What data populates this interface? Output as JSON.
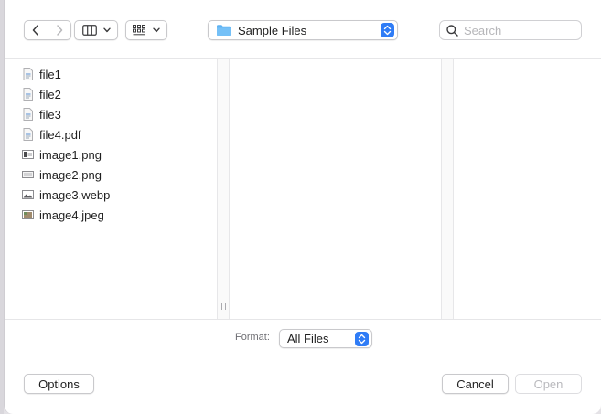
{
  "toolbar": {
    "back_icon": "chevron-left-icon",
    "forward_icon": "chevron-right-icon",
    "view_mode_icon": "columns-view-icon",
    "group_icon": "grid-group-icon",
    "location": "Sample Files",
    "search_placeholder": "Search",
    "search_value": ""
  },
  "files": [
    {
      "name": "file1",
      "icon": "document-icon"
    },
    {
      "name": "file2",
      "icon": "document-icon"
    },
    {
      "name": "file3",
      "icon": "document-icon"
    },
    {
      "name": "file4.pdf",
      "icon": "document-icon"
    },
    {
      "name": "image1.png",
      "icon": "image-file-icon"
    },
    {
      "name": "image2.png",
      "icon": "image-file-icon"
    },
    {
      "name": "image3.webp",
      "icon": "image-file-icon"
    },
    {
      "name": "image4.jpeg",
      "icon": "image-file-icon"
    }
  ],
  "footer": {
    "format_label": "Format:",
    "format_value": "All Files",
    "options_label": "Options",
    "cancel_label": "Cancel",
    "open_label": "Open"
  },
  "colors": {
    "accent": "#2f7cf6",
    "folder": "#5eb2f2",
    "disabled_text": "#b9b9bd"
  }
}
